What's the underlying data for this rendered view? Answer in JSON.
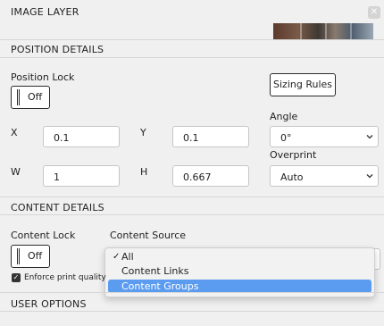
{
  "header": {
    "title": "IMAGE LAYER",
    "close_icon": "close-icon"
  },
  "position_details": {
    "section_title": "POSITION DETAILS",
    "position_lock": {
      "label": "Position Lock",
      "value": "Off"
    },
    "sizing_rules_button": "Sizing Rules",
    "x": {
      "label": "X",
      "value": "0.1"
    },
    "y": {
      "label": "Y",
      "value": "0.1"
    },
    "w": {
      "label": "W",
      "value": "1"
    },
    "h": {
      "label": "H",
      "value": "0.667"
    },
    "angle": {
      "label": "Angle",
      "value": "0°"
    },
    "overprint": {
      "label": "Overprint",
      "value": "Auto"
    }
  },
  "content_details": {
    "section_title": "CONTENT DETAILS",
    "content_lock": {
      "label": "Content Lock",
      "value": "Off"
    },
    "content_source": {
      "label": "Content Source",
      "options": [
        {
          "label": "All",
          "checked": true
        },
        {
          "label": "Content Links",
          "checked": false
        },
        {
          "label": "Content Groups",
          "checked": false,
          "highlighted": true
        }
      ],
      "check_mark": "✓"
    },
    "enforce_print_quality": {
      "label": "Enforce print quality",
      "checked": true
    }
  },
  "user_options": {
    "section_title": "USER OPTIONS"
  },
  "colors": {
    "highlight": "#5b9cf0",
    "background": "#f0f0f0",
    "border": "#2b2b2b"
  }
}
